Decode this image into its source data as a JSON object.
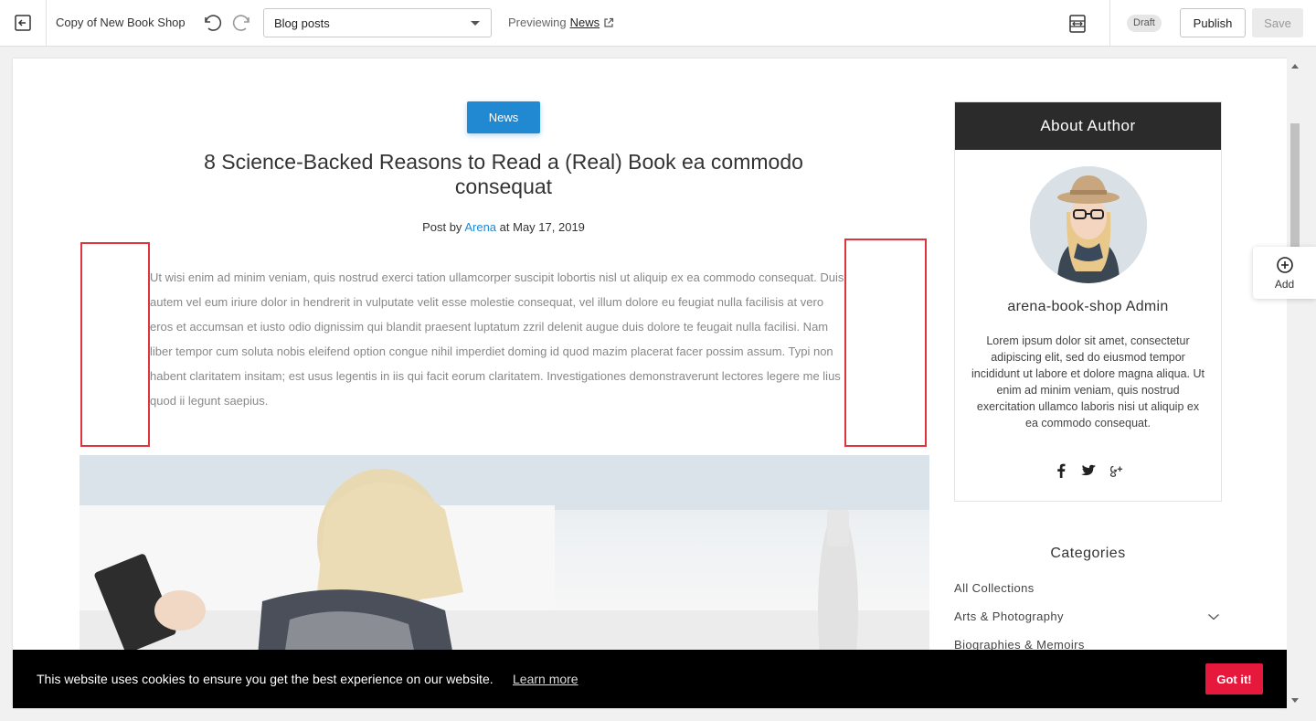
{
  "editor": {
    "theme_name": "Copy of New Book Shop",
    "page_select_value": "Blog posts",
    "previewing_label": "Previewing",
    "previewing_link": "News",
    "status_badge": "Draft",
    "publish_label": "Publish",
    "save_label": "Save",
    "add_label": "Add"
  },
  "post": {
    "category_tag": "News",
    "title": "8 Science-Backed Reasons to Read a (Real) Book ea commodo consequat",
    "meta_prefix": "Post by",
    "author": "Arena",
    "meta_date": "at May 17, 2019",
    "body": "Ut wisi enim ad minim veniam, quis nostrud exerci tation ullamcorper suscipit lobortis nisl ut aliquip ex ea commodo consequat. Duis autem vel eum iriure dolor in hendrerit in vulputate velit esse molestie consequat, vel illum dolore eu feugiat nulla facilisis at vero eros et accumsan et iusto odio dignissim qui blandit praesent luptatum zzril delenit augue duis dolore te feugait nulla facilisi. Nam liber tempor cum soluta nobis eleifend option congue nihil imperdiet doming id quod mazim placerat facer possim assum. Typi non habent claritatem insitam; est usus legentis in iis qui facit eorum claritatem. Investigationes demonstraverunt lectores legere me lius quod ii legunt saepius."
  },
  "sidebar": {
    "about_heading": "About Author",
    "author_name": "arena-book-shop Admin",
    "author_bio": "Lorem ipsum dolor sit amet, consectetur adipiscing elit, sed do eiusmod tempor incididunt ut labore et dolore magna aliqua. Ut enim ad minim veniam, quis nostrud exercitation ullamco laboris nisi ut aliquip ex ea commodo consequat.",
    "social_icons": [
      "facebook-icon",
      "twitter-icon",
      "google-plus-icon"
    ],
    "categories_heading": "Categories",
    "categories": [
      {
        "label": "All Collections"
      },
      {
        "label": "Arts & Photography"
      },
      {
        "label": "Biographies & Memoirs"
      }
    ]
  },
  "cookie": {
    "message": "This website uses cookies to ensure you get the best experience on our website.",
    "learn_more": "Learn more",
    "accept": "Got it!"
  },
  "colors": {
    "accent": "#2188d2",
    "cookie_button": "#e6193d",
    "author_header_bg": "#2b2b2b",
    "highlight_box": "#e0333c"
  }
}
